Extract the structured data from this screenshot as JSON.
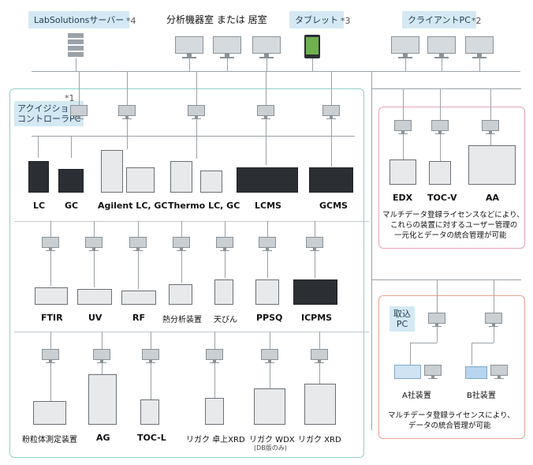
{
  "top": {
    "server_label": "LabSolutionsサーバー",
    "server_note": "*4",
    "room_label": "分析機器室 または 居室",
    "tablet_label": "タブレット",
    "tablet_note": "*3",
    "client_label": "クライアントPC",
    "client_note": "*2"
  },
  "acq": {
    "note": "*1",
    "label_line1": "アクイジション",
    "label_line2": "コントローラPC"
  },
  "row1": [
    "LC",
    "GC",
    "Agilent LC, GC",
    "Thermo LC, GC",
    "LCMS",
    "GCMS"
  ],
  "row2": [
    "FTIR",
    "UV",
    "RF",
    "熱分析装置",
    "天びん",
    "PPSQ",
    "ICPMS"
  ],
  "row3": [
    "粉粒体測定装置",
    "AG",
    "TOC-L",
    "リガク 卓上XRD",
    "リガク WDX",
    "リガク XRD"
  ],
  "row3_sub": "(DB版のみ)",
  "right1": {
    "instruments": [
      "EDX",
      "TOC-V",
      "AA"
    ],
    "desc_line1": "マルチデータ登録ライセンスなどにより、",
    "desc_line2": "これらの装置に対するユーザー管理の",
    "desc_line3": "一元化とデータの統合管理が可能",
    "border_color": "#e8a0c0"
  },
  "right2": {
    "label_line1": "取込",
    "label_line2": "PC",
    "instruments": [
      "A社装置",
      "B社装置"
    ],
    "desc_line1": "マルチデータ登録ライセンスにより、",
    "desc_line2": "データの統合管理が可能",
    "border_color": "#e8a090"
  },
  "main_box_color": "#8fd0c8"
}
